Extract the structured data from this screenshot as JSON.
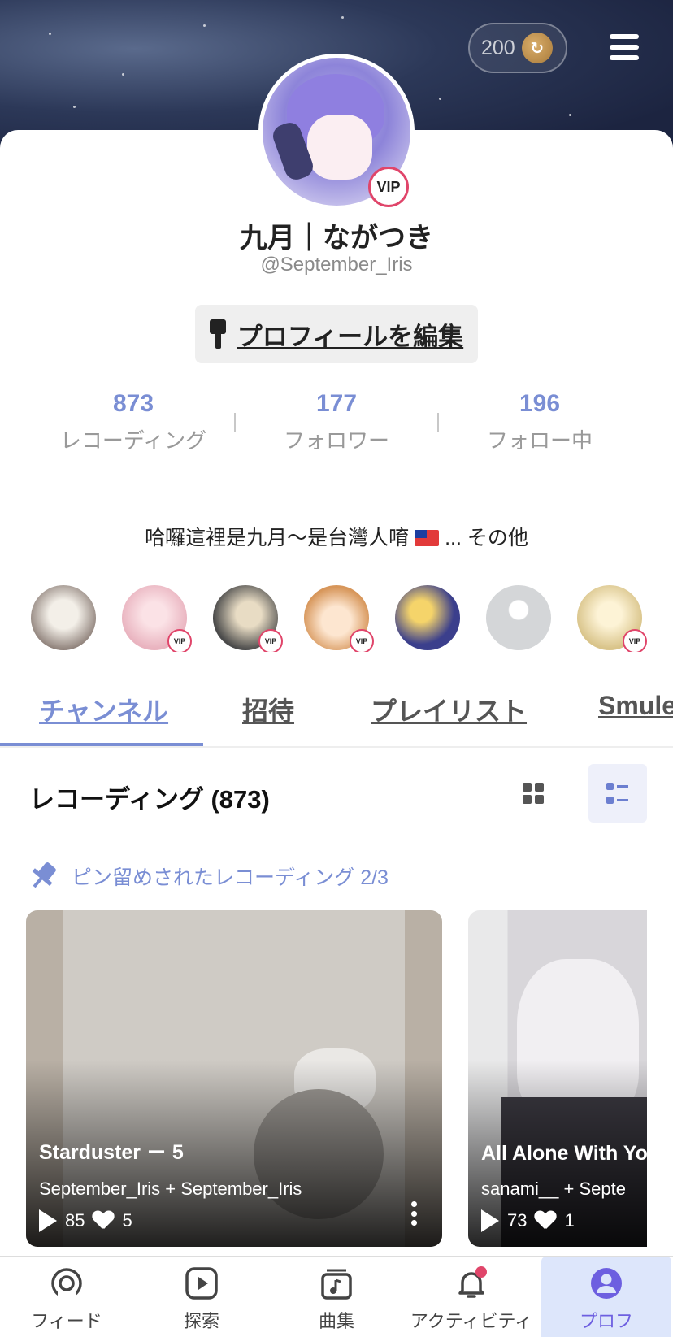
{
  "header": {
    "coin_amount": "200",
    "coin_symbol": "↻"
  },
  "profile": {
    "display_name": "九月｜ながつき",
    "handle": "@September_Iris",
    "vip_badge": "VIP",
    "edit_button": "プロフィールを編集",
    "bio": "哈囉這裡是九月～是台灣人唷",
    "bio_more": "... その他"
  },
  "stats": [
    {
      "value": "873",
      "label": "レコーディング"
    },
    {
      "value": "177",
      "label": "フォロワー"
    },
    {
      "value": "196",
      "label": "フォロー中"
    }
  ],
  "followers": {
    "vip_label": "VIP",
    "items": [
      {
        "vip": false,
        "color": "#8a7c75"
      },
      {
        "vip": true,
        "color": "#e9b3bf"
      },
      {
        "vip": true,
        "color": "#5a5a5a"
      },
      {
        "vip": true,
        "color": "#d7965a"
      },
      {
        "vip": false,
        "color": "#3b3f8c"
      },
      {
        "vip": false,
        "color": "#d4d6d8"
      },
      {
        "vip": true,
        "color": "#d9c48a"
      }
    ]
  },
  "tabs": [
    {
      "label": "チャンネル",
      "active": true
    },
    {
      "label": "招待",
      "active": false
    },
    {
      "label": "プレイリスト",
      "active": false
    },
    {
      "label": "Smule",
      "active": false
    }
  ],
  "recordings": {
    "title": "レコーディング (873)",
    "pinned_label": "ピン留めされたレコーディング 2/3",
    "items": [
      {
        "title": "Starduster － 5",
        "artists": "September_Iris + September_Iris",
        "plays": "85",
        "likes": "5"
      },
      {
        "title": "All Alone With Yo",
        "artists": "sanami__ + Septe",
        "plays": "73",
        "likes": "1"
      }
    ]
  },
  "bottom_nav": [
    {
      "label": "フィード",
      "icon": "feed-icon",
      "active": false
    },
    {
      "label": "探索",
      "icon": "explore-play-icon",
      "active": false
    },
    {
      "label": "曲集",
      "icon": "songbook-icon",
      "active": false
    },
    {
      "label": "アクティビティ",
      "icon": "bell-icon",
      "active": false
    },
    {
      "label": "プロフ",
      "icon": "profile-icon",
      "active": true
    }
  ],
  "colors": {
    "accent": "#7a8ed4",
    "vip_ring": "#e0456a",
    "notification_dot": "#e0456a",
    "active_nav_bg": "#dde6fb"
  }
}
